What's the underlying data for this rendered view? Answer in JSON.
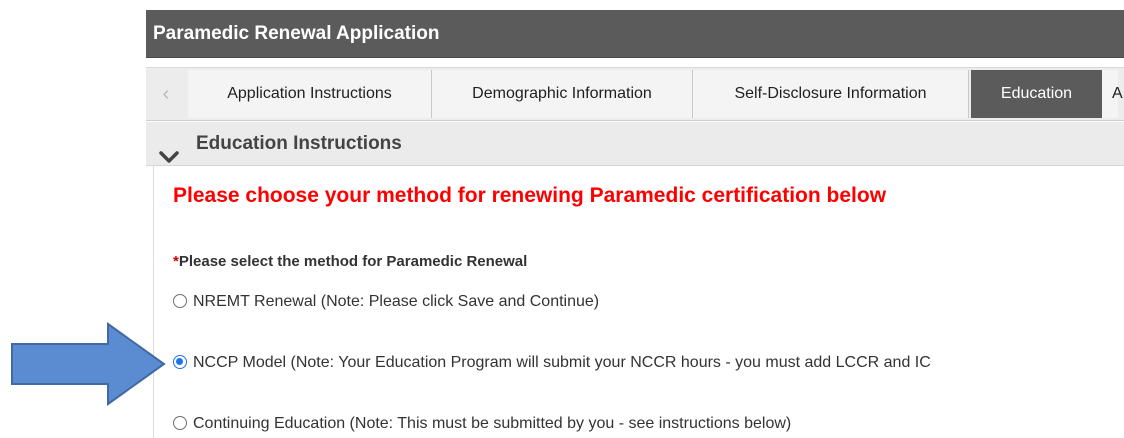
{
  "header": {
    "title": "Paramedic Renewal Application",
    "bg": "#5b5b5b"
  },
  "tabs": {
    "scroll_left_icon": "chevron-left-icon",
    "items": [
      {
        "label": "Application Instructions",
        "active": false
      },
      {
        "label": "Demographic Information",
        "active": false
      },
      {
        "label": "Self-Disclosure Information",
        "active": false
      },
      {
        "label": "Education",
        "active": true
      },
      {
        "label": "A",
        "active": false
      }
    ]
  },
  "section": {
    "icon": "chevron-down-icon",
    "title": "Education Instructions"
  },
  "instructions": {
    "text": "Please choose your method for renewing Paramedic certification below",
    "color": "#ff0000"
  },
  "question": {
    "required_marker": "*",
    "label": "Please select the method for Paramedic Renewal",
    "options": [
      {
        "label": "NREMT Renewal (Note: Please click Save and Continue)",
        "selected": false
      },
      {
        "label": "NCCP Model (Note: Your Education Program will submit your NCCR hours - you must add LCCR and IC",
        "selected": true
      },
      {
        "label": "Continuing Education (Note: This must be submitted by you - see instructions below)",
        "selected": false
      }
    ]
  },
  "annotation": {
    "icon": "arrow-right-icon",
    "color": "#4f81bd"
  }
}
